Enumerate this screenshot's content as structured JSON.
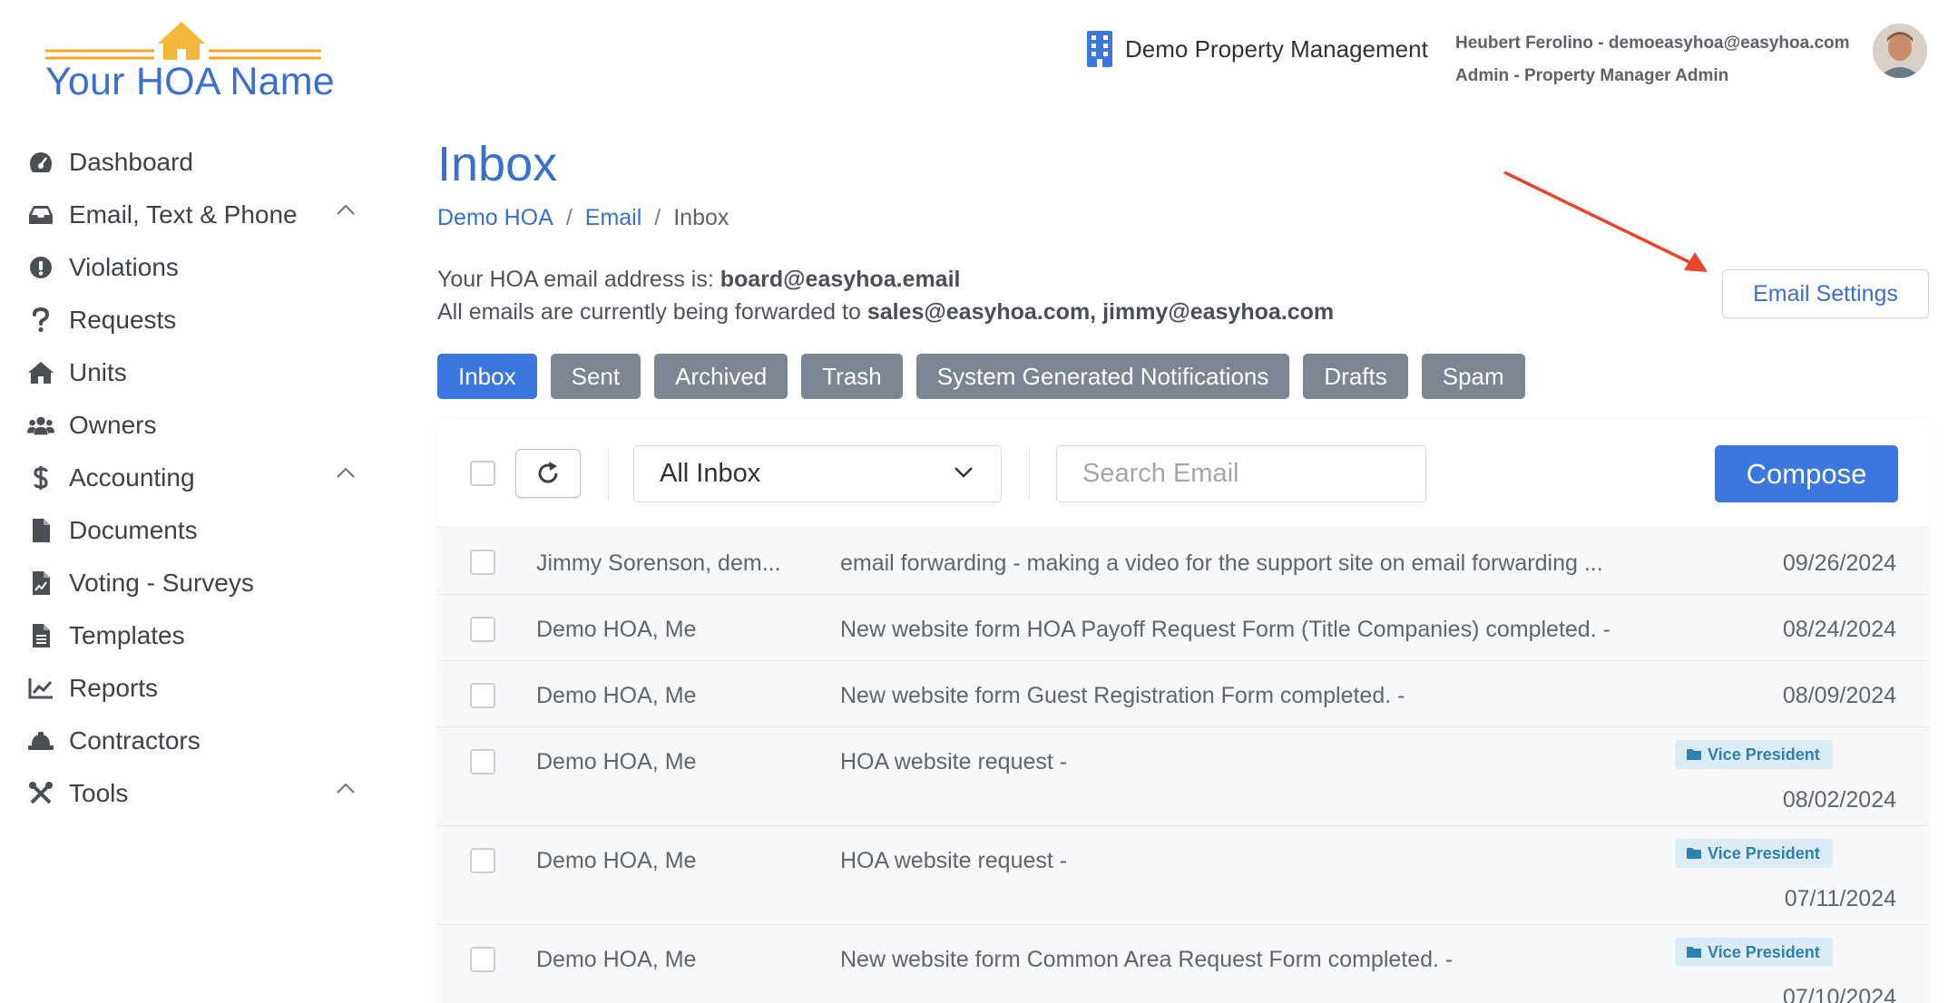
{
  "logo": {
    "text": "Your HOA Name"
  },
  "header": {
    "company": "Demo Property Management",
    "user_line": "Heubert Ferolino - demoeasyhoa@easyhoa.com",
    "role_line": "Admin - Property Manager Admin"
  },
  "sidebar": {
    "items": [
      {
        "label": "Dashboard",
        "icon": "gauge-icon"
      },
      {
        "label": "Email, Text & Phone",
        "icon": "inbox-tray-icon",
        "expandable": true
      },
      {
        "label": "Violations",
        "icon": "exclamation-circle-icon"
      },
      {
        "label": "Requests",
        "icon": "question-mark-icon"
      },
      {
        "label": "Units",
        "icon": "house-icon"
      },
      {
        "label": "Owners",
        "icon": "users-icon"
      },
      {
        "label": "Accounting",
        "icon": "dollar-icon",
        "expandable": true
      },
      {
        "label": "Documents",
        "icon": "file-icon"
      },
      {
        "label": "Voting - Surveys",
        "icon": "file-chart-icon"
      },
      {
        "label": "Templates",
        "icon": "file-lines-icon"
      },
      {
        "label": "Reports",
        "icon": "line-chart-icon"
      },
      {
        "label": "Contractors",
        "icon": "hard-hat-icon"
      },
      {
        "label": "Tools",
        "icon": "tools-icon",
        "expandable": true
      }
    ]
  },
  "main": {
    "title": "Inbox",
    "breadcrumb": [
      "Demo HOA",
      "Email",
      "Inbox"
    ],
    "info_prefix": "Your HOA email address is: ",
    "hoa_email": "board@easyhoa.email",
    "forward_prefix": "All emails are currently being forwarded to ",
    "forward_emails": "sales@easyhoa.com, jimmy@easyhoa.com",
    "settings_button": "Email Settings",
    "tabs": [
      "Inbox",
      "Sent",
      "Archived",
      "Trash",
      "System Generated Notifications",
      "Drafts",
      "Spam"
    ],
    "active_tab": "Inbox"
  },
  "toolbar": {
    "filter_value": "All Inbox",
    "search_placeholder": "Search Email",
    "compose_label": "Compose"
  },
  "emails": [
    {
      "sender": "Jimmy Sorenson, dem...",
      "subject": "email forwarding - making a video for the support site on email forwarding ...",
      "date": "09/26/2024",
      "badge": ""
    },
    {
      "sender": "Demo HOA, Me",
      "subject": "New website form HOA Payoff Request Form (Title Companies) completed. -",
      "date": "08/24/2024",
      "badge": ""
    },
    {
      "sender": "Demo HOA, Me",
      "subject": "New website form Guest Registration Form completed. -",
      "date": "08/09/2024",
      "badge": ""
    },
    {
      "sender": "Demo HOA, Me",
      "subject": "HOA website request -",
      "date": "08/02/2024",
      "badge": "Vice President"
    },
    {
      "sender": "Demo HOA, Me",
      "subject": "HOA website request -",
      "date": "07/11/2024",
      "badge": "Vice President"
    },
    {
      "sender": "Demo HOA, Me",
      "subject": "New website form Common Area Request Form completed. -",
      "date": "07/10/2024",
      "badge": "Vice President"
    }
  ],
  "colors": {
    "accent": "#3a77de",
    "heading": "#3a6fce",
    "tab_inactive": "#7d8592",
    "badge_bg": "#dcecf6",
    "badge_text": "#2e7fb3",
    "arrow": "#e8452c",
    "logo_orange": "#f5a623"
  }
}
